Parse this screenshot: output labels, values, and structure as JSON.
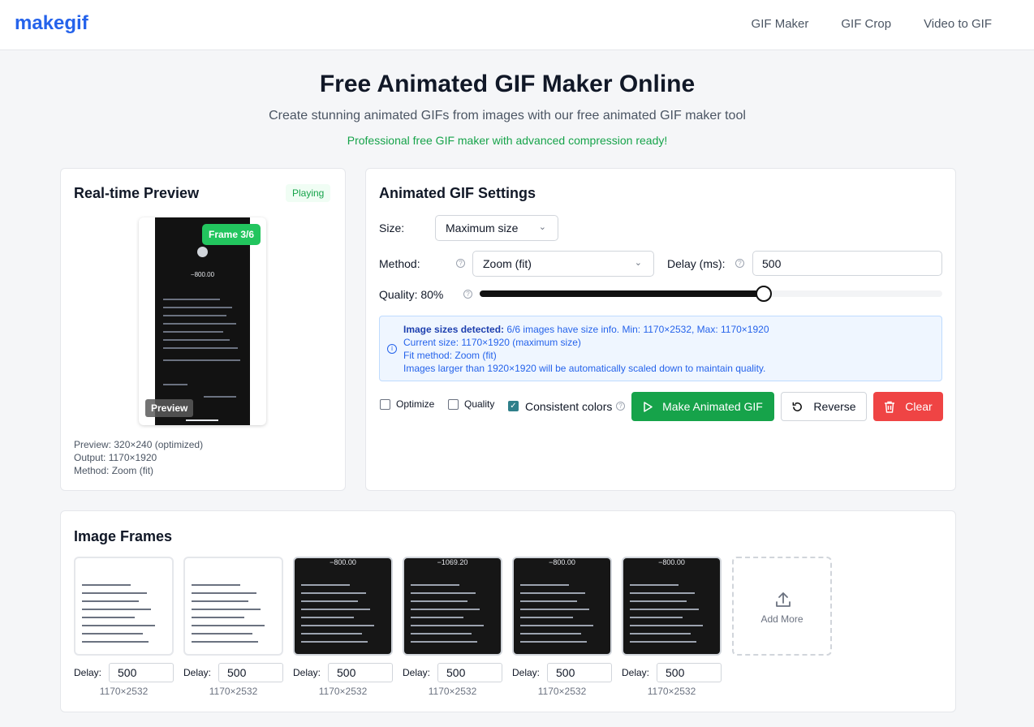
{
  "nav": {
    "logo": "makegif",
    "links": [
      "GIF Maker",
      "GIF Crop",
      "Video to GIF"
    ]
  },
  "hero": {
    "title": "Free Animated GIF Maker Online",
    "subtitle": "Create stunning animated GIFs from images with our free animated GIF maker tool",
    "note": "Professional free GIF maker with advanced compression ready!"
  },
  "preview": {
    "title": "Real-time Preview",
    "status": "Playing",
    "frame_badge": "Frame 3/6",
    "preview_tag": "Preview",
    "amount": "−800.00",
    "info": [
      "Preview: 320×240 (optimized)",
      "Output: 1170×1920",
      "Method: Zoom (fit)"
    ]
  },
  "settings": {
    "title": "Animated GIF Settings",
    "size_label": "Size:",
    "size_value": "Maximum size",
    "method_label": "Method:",
    "method_value": "Zoom (fit)",
    "delay_label": "Delay (ms):",
    "delay_value": "500",
    "quality_label": "Quality: 80%",
    "quality_fraction": 0.8,
    "notice": {
      "heading": "Image sizes detected:",
      "line1_rest": " 6/6 images have size info. Min: 1170×2532, Max: 1170×1920",
      "line2": "Current size: 1170×1920 (maximum size)",
      "line3": "Fit method: Zoom (fit)",
      "line4": "Images larger than 1920×1920 will be automatically scaled down to maintain quality."
    },
    "options": {
      "optimize": "Optimize",
      "quality": "Quality",
      "consistent": "Consistent colors"
    },
    "buttons": {
      "make": "Make Animated GIF",
      "reverse": "Reverse",
      "clear": "Clear"
    }
  },
  "frames": {
    "title": "Image Frames",
    "delay_label": "Delay:",
    "add_more": "Add More",
    "items": [
      {
        "theme": "light",
        "amount": "",
        "delay": "500",
        "dims": "1170×2532"
      },
      {
        "theme": "light",
        "amount": "",
        "delay": "500",
        "dims": "1170×2532"
      },
      {
        "theme": "dark",
        "amount": "−800.00",
        "delay": "500",
        "dims": "1170×2532"
      },
      {
        "theme": "dark",
        "amount": "−1069.20",
        "delay": "500",
        "dims": "1170×2532"
      },
      {
        "theme": "dark",
        "amount": "−800.00",
        "delay": "500",
        "dims": "1170×2532"
      },
      {
        "theme": "dark",
        "amount": "−800.00",
        "delay": "500",
        "dims": "1170×2532"
      }
    ]
  },
  "colors": {
    "brand": "#2563eb",
    "success": "#16a34a",
    "danger": "#ef4444"
  }
}
